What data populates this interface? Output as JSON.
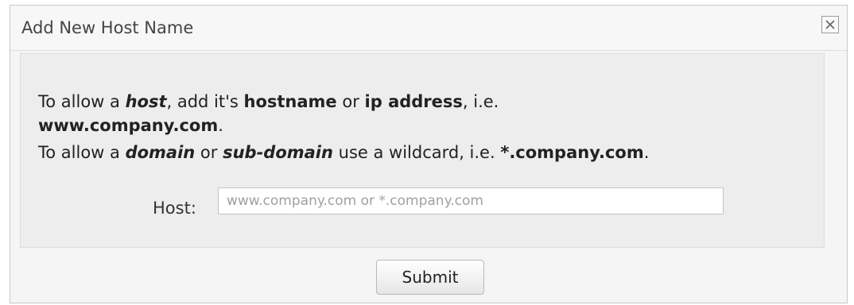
{
  "dialog": {
    "title": "Add New Host Name",
    "close_label": "×",
    "instructions": {
      "line1": {
        "p1": "To allow a ",
        "host": "host",
        "p2": ", add it's ",
        "hostname": "hostname",
        "p3": " or ",
        "ip_address": "ip address",
        "p4": ", i.e."
      },
      "line2": {
        "example": "www.company.com",
        "p1": "."
      },
      "line3": {
        "p1": "To allow a ",
        "domain": "domain",
        "p2": " or ",
        "sub_domain": "sub-domain",
        "p3": " use a wildcard, i.e. ",
        "wildcard_example": "*.company.com",
        "p4": "."
      }
    },
    "host_field": {
      "label": "Host:",
      "value": "",
      "placeholder": "www.company.com or *.company.com"
    },
    "submit_label": "Submit"
  }
}
